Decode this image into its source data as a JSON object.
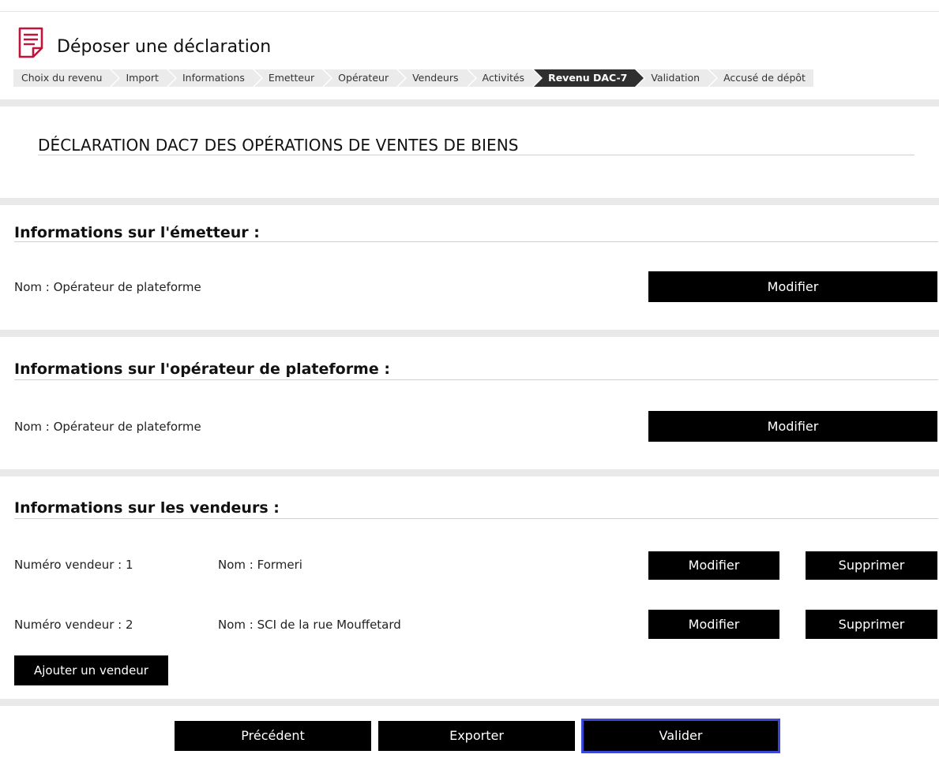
{
  "header": {
    "title": "Déposer une déclaration",
    "icon": "document-icon",
    "accent": "#c0143c"
  },
  "breadcrumb": {
    "steps": [
      {
        "label": "Choix du revenu",
        "active": false
      },
      {
        "label": "Import",
        "active": false
      },
      {
        "label": "Informations",
        "active": false
      },
      {
        "label": "Emetteur",
        "active": false
      },
      {
        "label": "Opérateur",
        "active": false
      },
      {
        "label": "Vendeurs",
        "active": false
      },
      {
        "label": "Activités",
        "active": false
      },
      {
        "label": "Revenu DAC-7",
        "active": true
      },
      {
        "label": "Validation",
        "active": false
      },
      {
        "label": "Accusé de dépôt",
        "active": false
      }
    ]
  },
  "main": {
    "title": "DÉCLARATION DAC7 DES OPÉRATIONS DE VENTES DE BIENS"
  },
  "emetteur": {
    "title": "Informations sur l'émetteur :",
    "name": "Nom : Opérateur de plateforme",
    "edit_label": "Modifier"
  },
  "operateur": {
    "title": "Informations sur l'opérateur de plateforme :",
    "name": "Nom : Opérateur de plateforme",
    "edit_label": "Modifier"
  },
  "vendeurs": {
    "title": "Informations sur les vendeurs :",
    "rows": [
      {
        "numero": "Numéro vendeur : 1",
        "nom": "Nom : Formeri",
        "edit_label": "Modifier",
        "delete_label": "Supprimer"
      },
      {
        "numero": "Numéro vendeur : 2",
        "nom": "Nom : SCI de la rue Mouffetard",
        "edit_label": "Modifier",
        "delete_label": "Supprimer"
      }
    ],
    "add_label": "Ajouter un vendeur"
  },
  "footer": {
    "previous_label": "Précédent",
    "export_label": "Exporter",
    "validate_label": "Valider",
    "focus_color": "#3b48d6"
  }
}
